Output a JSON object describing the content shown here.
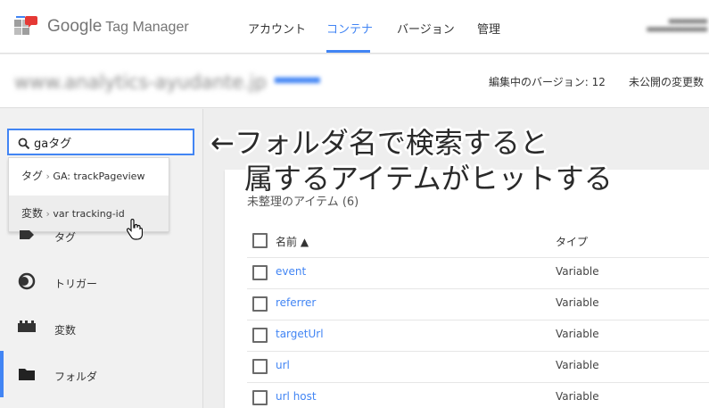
{
  "header": {
    "brand_google": "Google",
    "brand_product": "Tag Manager",
    "nav": [
      {
        "label": "アカウント",
        "active": false
      },
      {
        "label": "コンテナ",
        "active": true
      },
      {
        "label": "バージョン",
        "active": false
      },
      {
        "label": "管理",
        "active": false
      }
    ]
  },
  "container": {
    "name": "www.analytics-ayudante.jp",
    "version_label": "編集中のバージョン: 12",
    "unpublished_label": "未公開の変更数"
  },
  "search": {
    "value": "gaタグ",
    "suggestions": [
      {
        "kind": "タグ",
        "sep": "›",
        "name": "GA: trackPageview"
      },
      {
        "kind": "変数",
        "sep": "›",
        "name": "var tracking-id"
      }
    ]
  },
  "sidebar": {
    "items": [
      {
        "label": "タグ",
        "icon": "tag-icon"
      },
      {
        "label": "トリガー",
        "icon": "trigger-icon"
      },
      {
        "label": "変数",
        "icon": "variables-icon"
      },
      {
        "label": "フォルダ",
        "icon": "folder-icon",
        "active": true
      }
    ]
  },
  "main": {
    "card_title": "未整理のアイテム (6)",
    "columns": {
      "name": "名前 ▲",
      "type": "タイプ"
    },
    "rows": [
      {
        "name": "event",
        "type": "Variable"
      },
      {
        "name": "referrer",
        "type": "Variable"
      },
      {
        "name": "targetUrl",
        "type": "Variable"
      },
      {
        "name": "url",
        "type": "Variable"
      },
      {
        "name": "url host",
        "type": "Variable"
      }
    ]
  },
  "annotation": {
    "line1": "←フォルダ名で検索すると",
    "line2": "属するアイテムがヒットする"
  },
  "colors": {
    "accent": "#4285f4",
    "sidebar_bg": "#f1f1f1"
  }
}
